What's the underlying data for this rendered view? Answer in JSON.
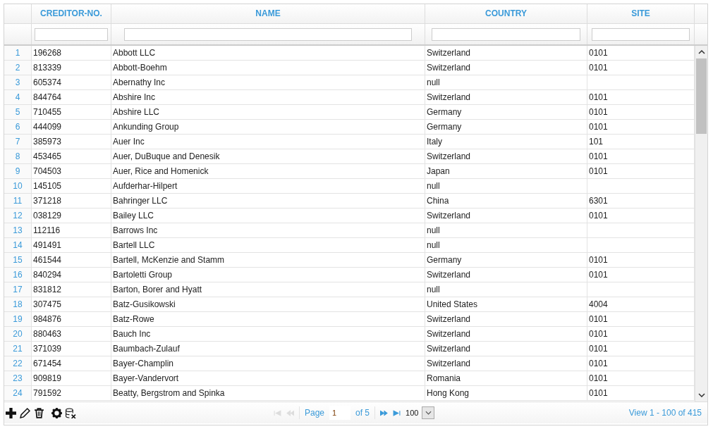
{
  "table": {
    "columns": [
      {
        "label": "CREDITOR-NO."
      },
      {
        "label": "NAME"
      },
      {
        "label": "COUNTRY"
      },
      {
        "label": "SITE"
      }
    ],
    "rows": [
      {
        "num": "1",
        "cells": [
          "196268",
          "Abbott LLC",
          "Switzerland",
          "0101"
        ]
      },
      {
        "num": "2",
        "cells": [
          "813339",
          "Abbott-Boehm",
          "Switzerland",
          "0101"
        ]
      },
      {
        "num": "3",
        "cells": [
          "605374",
          "Abernathy Inc",
          "null",
          ""
        ]
      },
      {
        "num": "4",
        "cells": [
          "844764",
          "Abshire Inc",
          "Switzerland",
          "0101"
        ]
      },
      {
        "num": "5",
        "cells": [
          "710455",
          "Abshire LLC",
          "Germany",
          "0101"
        ]
      },
      {
        "num": "6",
        "cells": [
          "444099",
          "Ankunding Group",
          "Germany",
          "0101"
        ]
      },
      {
        "num": "7",
        "cells": [
          "385973",
          "Auer Inc",
          "Italy",
          "101"
        ]
      },
      {
        "num": "8",
        "cells": [
          "453465",
          "Auer, DuBuque and Denesik",
          "Switzerland",
          "0101"
        ]
      },
      {
        "num": "9",
        "cells": [
          "704503",
          "Auer, Rice and Homenick",
          "Japan",
          "0101"
        ]
      },
      {
        "num": "10",
        "cells": [
          "145105",
          "Aufderhar-Hilpert",
          "null",
          ""
        ]
      },
      {
        "num": "11",
        "cells": [
          "371218",
          "Bahringer LLC",
          "China",
          "6301"
        ]
      },
      {
        "num": "12",
        "cells": [
          "038129",
          "Bailey LLC",
          "Switzerland",
          "0101"
        ]
      },
      {
        "num": "13",
        "cells": [
          "112116",
          "Barrows Inc",
          "null",
          ""
        ]
      },
      {
        "num": "14",
        "cells": [
          "491491",
          "Bartell LLC",
          "null",
          ""
        ]
      },
      {
        "num": "15",
        "cells": [
          "461544",
          "Bartell, McKenzie and Stamm",
          "Germany",
          "0101"
        ]
      },
      {
        "num": "16",
        "cells": [
          "840294",
          "Bartoletti Group",
          "Switzerland",
          "0101"
        ]
      },
      {
        "num": "17",
        "cells": [
          "831812",
          "Barton, Borer and Hyatt",
          "null",
          ""
        ]
      },
      {
        "num": "18",
        "cells": [
          "307475",
          "Batz-Gusikowski",
          "United States",
          "4004"
        ]
      },
      {
        "num": "19",
        "cells": [
          "984876",
          "Batz-Rowe",
          "Switzerland",
          "0101"
        ]
      },
      {
        "num": "20",
        "cells": [
          "880463",
          "Bauch Inc",
          "Switzerland",
          "0101"
        ]
      },
      {
        "num": "21",
        "cells": [
          "371039",
          "Baumbach-Zulauf",
          "Switzerland",
          "0101"
        ]
      },
      {
        "num": "22",
        "cells": [
          "671454",
          "Bayer-Champlin",
          "Switzerland",
          "0101"
        ]
      },
      {
        "num": "23",
        "cells": [
          "909819",
          "Bayer-Vandervort",
          "Romania",
          "0101"
        ]
      },
      {
        "num": "24",
        "cells": [
          "791592",
          "Beatty, Bergstrom and Spinka",
          "Hong Kong",
          "0101"
        ]
      }
    ]
  },
  "toolbar": [
    {
      "kind": "add"
    },
    {
      "kind": "edit"
    },
    {
      "kind": "delete"
    },
    {
      "kind": "settings"
    },
    {
      "kind": "clear"
    }
  ],
  "pager": {
    "buttons": [
      {
        "kind": "first",
        "disabled": true
      },
      {
        "kind": "prev",
        "disabled": true
      },
      {
        "kind": "next",
        "disabled": false
      },
      {
        "kind": "last",
        "disabled": false
      }
    ],
    "page_label": "Page",
    "page_value": "1",
    "of_label": "of 5",
    "page_size": "100"
  },
  "record_info": "View 1 - 100 of 415"
}
